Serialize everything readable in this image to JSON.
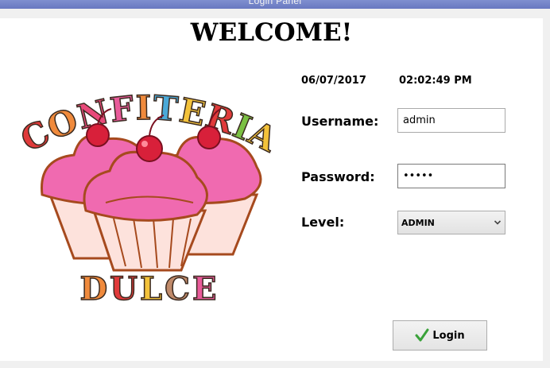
{
  "window": {
    "title": "Login Panel"
  },
  "header": {
    "welcome": "WELCOME!"
  },
  "status": {
    "date": "06/07/2017",
    "time": "02:02:49 PM"
  },
  "logo": {
    "top_text": "CONFITERIA",
    "bottom_text": "DULCE",
    "letter_colors": [
      "#e03a3a",
      "#f08a3c",
      "#f3c23a",
      "#4aa9d8",
      "#7bc043",
      "#e95a9a"
    ]
  },
  "form": {
    "username_label": "Username:",
    "username_value": "admin",
    "password_label": "Password:",
    "password_value": "•••••",
    "level_label": "Level:",
    "level_value": "ADMIN"
  },
  "actions": {
    "login_label": "Login",
    "login_icon": "checkmark-icon"
  },
  "colors": {
    "titlebar": "#7080c8",
    "panel": "#ffffff",
    "cupcake_frosting": "#f06ab0",
    "cherry": "#d8203a"
  }
}
